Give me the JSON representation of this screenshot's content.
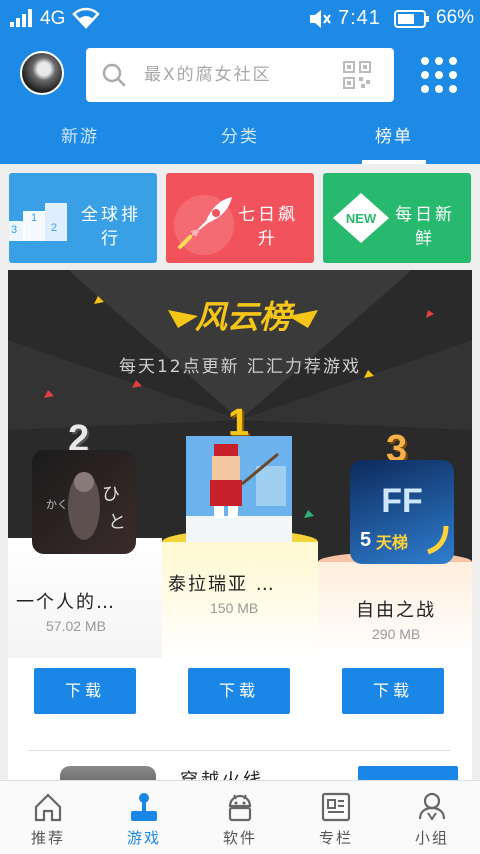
{
  "status_bar": {
    "network": "4G",
    "time": "7:41",
    "battery_text": "66%",
    "battery_level": 0.66,
    "icons": [
      "signal-icon",
      "wifi-icon",
      "mute-icon",
      "battery-icon"
    ]
  },
  "search": {
    "placeholder": "最X的腐女社区"
  },
  "tabs": [
    {
      "label": "新游",
      "active": false
    },
    {
      "label": "分类",
      "active": false
    },
    {
      "label": "榜单",
      "active": true
    }
  ],
  "categories": [
    {
      "label": "全球排行",
      "color": "#3aa0e6",
      "icon": "podium-icon"
    },
    {
      "label": "七日飙升",
      "color": "#f2525b",
      "icon": "rocket-icon"
    },
    {
      "label": "每日新鲜",
      "color": "#27b96d",
      "icon": "new-badge-icon"
    }
  ],
  "banner": {
    "title": "风云榜",
    "subtitle": "每天12点更新 汇汇力荐游戏"
  },
  "ranking": [
    {
      "rank": "1",
      "name": "泰拉瑞亚 …",
      "size": "150 MB",
      "button": "下载"
    },
    {
      "rank": "2",
      "name": "一个人的…",
      "size": "57.02 MB",
      "button": "下载"
    },
    {
      "rank": "3",
      "name": "自由之战",
      "size": "290 MB",
      "button": "下载"
    }
  ],
  "next_item": {
    "name": "穿越火线"
  },
  "bottom_nav": [
    {
      "label": "推荐",
      "icon": "home-icon",
      "active": false
    },
    {
      "label": "游戏",
      "icon": "joystick-icon",
      "active": true
    },
    {
      "label": "软件",
      "icon": "android-icon",
      "active": false
    },
    {
      "label": "专栏",
      "icon": "column-icon",
      "active": false
    },
    {
      "label": "小组",
      "icon": "group-icon",
      "active": false
    }
  ],
  "colors": {
    "primary": "#1d8ae5",
    "button": "#1a87e6",
    "gold": "#f5c518"
  }
}
